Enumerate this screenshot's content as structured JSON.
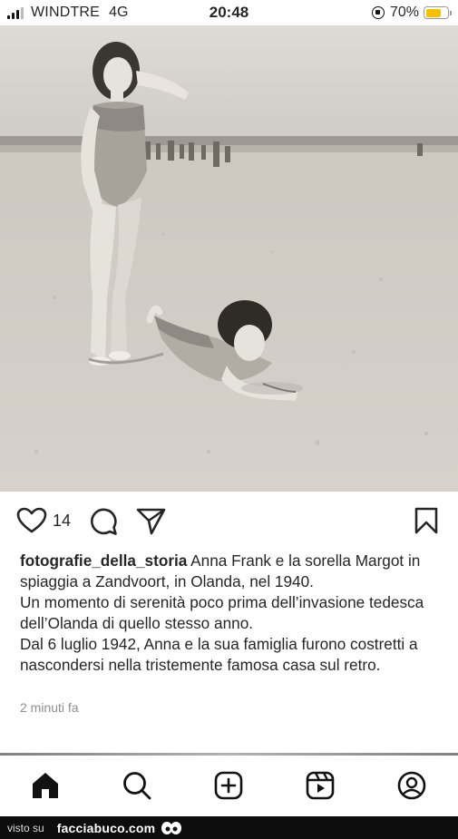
{
  "status_bar": {
    "carrier": "WINDTRE",
    "network": "4G",
    "time": "20:48",
    "battery": "70%",
    "battery_level": 0.7,
    "battery_color": "#f2c200"
  },
  "post": {
    "photo_icon": "beach-photo",
    "like_count": "14",
    "username": "fotografie_della_storia",
    "caption_lines": [
      "Anna Frank e la sorella Margot in spiaggia a Zandvoort, in Olanda, nel 1940.",
      "Un momento di serenità poco prima dell’invasione tedesca dell’Olanda di quello stesso anno.",
      "Dal 6 luglio 1942, Anna e la sua famiglia furono costretti a nascondersi nella tristemente famosa casa sul retro."
    ],
    "time_ago": "2 minuti fa"
  },
  "actions": {
    "like": "heart-icon",
    "comment": "comment-icon",
    "share": "send-icon",
    "save": "bookmark-icon"
  },
  "nav": {
    "items": [
      "home-icon",
      "search-icon",
      "create-icon",
      "reels-icon",
      "profile-icon"
    ]
  },
  "watermark": {
    "prefix": "visto su",
    "site": "facciabuco.com"
  }
}
